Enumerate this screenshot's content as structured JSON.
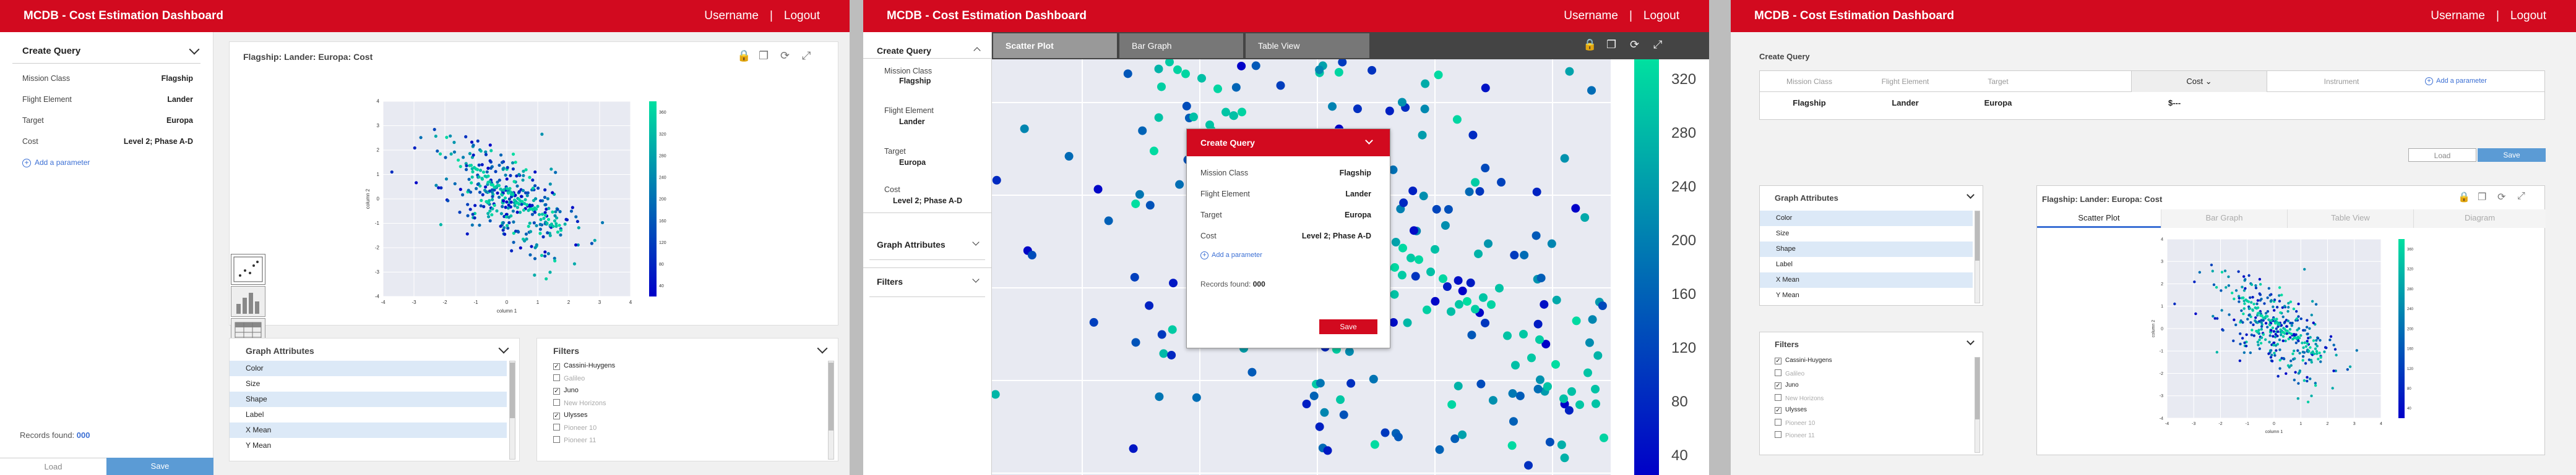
{
  "header": {
    "title": "MCDB - Cost Estimation Dashboard",
    "username": "Username",
    "separator": "|",
    "logout": "Logout"
  },
  "panel1": {
    "create_query": "Create Query",
    "rows": [
      {
        "label": "Mission Class",
        "value": "Flagship"
      },
      {
        "label": "Flight Element",
        "value": "Lander"
      },
      {
        "label": "Target",
        "value": "Europa"
      },
      {
        "label": "Cost",
        "value": "Level 2; Phase A-D"
      }
    ],
    "add_param": "Add a parameter",
    "records_label": "Records found:",
    "records_value": "000",
    "load": "Load",
    "save": "Save",
    "chart_title": "Flagship: Lander: Europa: Cost",
    "graph_attributes": "Graph Attributes",
    "attributes": [
      "Color",
      "Size",
      "Shape",
      "Label",
      "X Mean",
      "Y Mean"
    ],
    "filters": "Filters",
    "filter_items": [
      {
        "label": "Cassini-Huygens",
        "checked": true,
        "enabled": true
      },
      {
        "label": "Galileo",
        "checked": false,
        "enabled": false
      },
      {
        "label": "Juno",
        "checked": true,
        "enabled": true
      },
      {
        "label": "New Horizons",
        "checked": false,
        "enabled": false
      },
      {
        "label": "Ulysses",
        "checked": true,
        "enabled": true
      },
      {
        "label": "Pioneer 10",
        "checked": false,
        "enabled": false
      },
      {
        "label": "Pioneer 11",
        "checked": false,
        "enabled": false
      }
    ]
  },
  "panel2": {
    "tabs": [
      "Scatter Plot",
      "Bar Graph",
      "Table View"
    ],
    "sidebar": [
      {
        "label": "Mission Class",
        "value": "Flagship"
      },
      {
        "label": "Flight Element",
        "value": "Lander"
      },
      {
        "label": "Target",
        "value": "Europa"
      },
      {
        "label": "Cost",
        "value": "Level 2; Phase A-D"
      }
    ],
    "create_query": "Create Query",
    "graph_attributes": "Graph Attributes",
    "filters": "Filters",
    "modal": {
      "title": "Create Query",
      "rows": [
        {
          "label": "Mission Class",
          "value": "Flagship"
        },
        {
          "label": "Flight Element",
          "value": "Lander"
        },
        {
          "label": "Target",
          "value": "Europa"
        },
        {
          "label": "Cost",
          "value": "Level 2; Phase A-D"
        }
      ],
      "add_param": "Add a parameter",
      "records_label": "Records found:",
      "records_value": "000",
      "save": "Save"
    },
    "colorbar_ticks": [
      "320",
      "280",
      "240",
      "200",
      "160",
      "120",
      "80",
      "40"
    ]
  },
  "panel3": {
    "create_query": "Create Query",
    "columns": [
      "Mission Class",
      "Flight Element",
      "Target",
      "Cost",
      "Instrument"
    ],
    "add_param": "Add a parameter",
    "values": [
      "Flagship",
      "Lander",
      "Europa",
      "$---"
    ],
    "load": "Load",
    "save": "Save",
    "graph_attributes": "Graph Attributes",
    "attributes": [
      "Color",
      "Size",
      "Shape",
      "Label",
      "X Mean",
      "Y Mean"
    ],
    "filters": "Filters",
    "filter_items": [
      {
        "label": "Cassini-Huygens",
        "checked": true,
        "enabled": true
      },
      {
        "label": "Galileo",
        "checked": false,
        "enabled": false
      },
      {
        "label": "Juno",
        "checked": true,
        "enabled": true
      },
      {
        "label": "New Horizons",
        "checked": false,
        "enabled": false
      },
      {
        "label": "Ulysses",
        "checked": true,
        "enabled": true
      },
      {
        "label": "Pioneer 10",
        "checked": false,
        "enabled": false
      },
      {
        "label": "Pioneer 11",
        "checked": false,
        "enabled": false
      }
    ],
    "chart_title": "Flagship: Lander: Europa: Cost",
    "tabs": [
      "Scatter Plot",
      "Bar Graph",
      "Table View",
      "Diagram"
    ]
  },
  "chart_data": [
    {
      "type": "scatter",
      "xlabel": "column 1",
      "ylabel": "column 2",
      "xlim": [
        -4,
        4
      ],
      "ylim": [
        -4,
        4
      ],
      "xticks": [
        "-4",
        "-3",
        "-2",
        "-1",
        "0",
        "1",
        "2",
        "3",
        "4"
      ],
      "yticks": [
        "4",
        "3",
        "2",
        "1",
        "0",
        "-1",
        "-2",
        "-3",
        "-4"
      ],
      "colorbar_ticks": [
        "360",
        "320",
        "280",
        "240",
        "200",
        "160",
        "120",
        "80",
        "40"
      ],
      "colorbar_range": [
        0,
        360
      ],
      "grid": true,
      "colormap": [
        "#0000c8",
        "#00e0a0"
      ]
    }
  ],
  "colors": {
    "brand": "#d20a1f",
    "save_blue": "#5b9bd5",
    "plot_bg": "#e8eaf2"
  }
}
